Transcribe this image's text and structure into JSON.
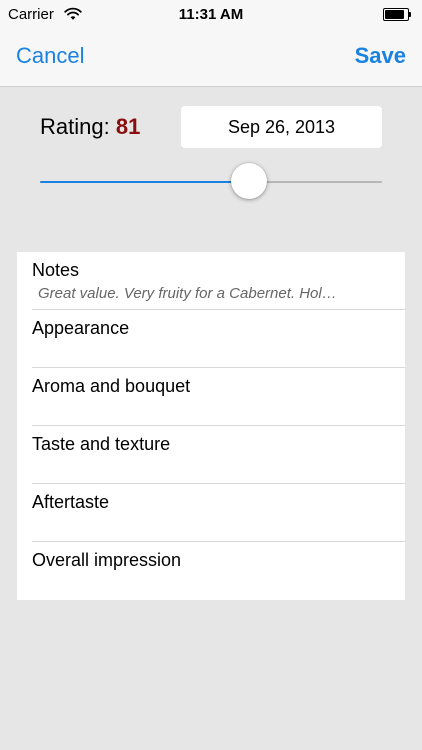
{
  "status_bar": {
    "carrier": "Carrier",
    "time": "11:31 AM",
    "battery_level": 0.9
  },
  "nav": {
    "cancel_label": "Cancel",
    "save_label": "Save"
  },
  "rating": {
    "label": "Rating:",
    "value": "81",
    "date": "Sep 26, 2013",
    "slider_level": 0.61
  },
  "sections": [
    {
      "title": "Notes",
      "subtitle": "Great value. Very fruity for a Cabernet. Hol…"
    },
    {
      "title": "Appearance",
      "subtitle": ""
    },
    {
      "title": "Aroma and bouquet",
      "subtitle": ""
    },
    {
      "title": "Taste and texture",
      "subtitle": ""
    },
    {
      "title": "Aftertaste",
      "subtitle": ""
    },
    {
      "title": "Overall impression",
      "subtitle": ""
    }
  ],
  "colors": {
    "accent": "#1a82e0",
    "rating_value": "#8b0e0e",
    "background": "#e6e6e6"
  }
}
